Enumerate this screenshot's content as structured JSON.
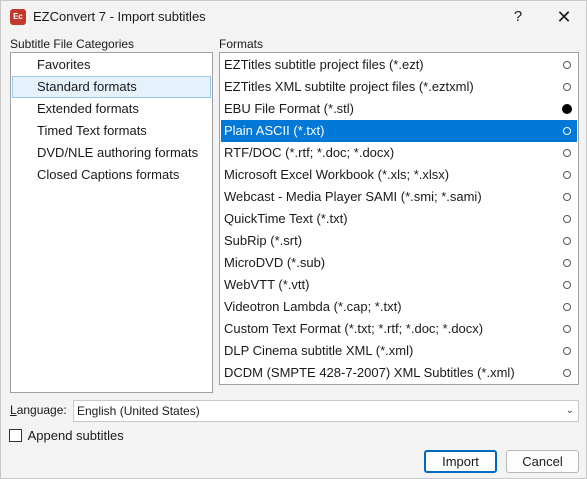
{
  "window": {
    "app_icon_text": "Ec",
    "title": "EZConvert 7 - Import subtitles",
    "help_glyph": "?",
    "close_glyph": "✕"
  },
  "categories": {
    "label": "Subtitle File Categories",
    "items": [
      {
        "label": "Favorites",
        "selected": false
      },
      {
        "label": "Standard formats",
        "selected": true
      },
      {
        "label": "Extended formats",
        "selected": false
      },
      {
        "label": "Timed Text formats",
        "selected": false
      },
      {
        "label": "DVD/NLE authoring formats",
        "selected": false
      },
      {
        "label": "Closed Captions formats",
        "selected": false
      }
    ]
  },
  "formats": {
    "label": "Formats",
    "items": [
      {
        "label": "EZTitles subtitle project files (*.ezt)",
        "marker": "hollow"
      },
      {
        "label": "EZTitles XML subtilte project files (*.eztxml)",
        "marker": "hollow"
      },
      {
        "label": "EBU File Format (*.stl)",
        "marker": "filled"
      },
      {
        "label": "Plain ASCII (*.txt)",
        "marker": "hollow",
        "selected": true
      },
      {
        "label": "RTF/DOC (*.rtf; *.doc; *.docx)",
        "marker": "hollow"
      },
      {
        "label": "Microsoft Excel Workbook (*.xls; *.xlsx)",
        "marker": "hollow"
      },
      {
        "label": "Webcast - Media Player SAMI (*.smi; *.sami)",
        "marker": "hollow"
      },
      {
        "label": "QuickTime Text (*.txt)",
        "marker": "hollow"
      },
      {
        "label": "SubRip (*.srt)",
        "marker": "hollow"
      },
      {
        "label": "MicroDVD (*.sub)",
        "marker": "hollow"
      },
      {
        "label": "WebVTT (*.vtt)",
        "marker": "hollow"
      },
      {
        "label": "Videotron Lambda (*.cap; *.txt)",
        "marker": "hollow"
      },
      {
        "label": "Custom Text Format (*.txt; *.rtf; *.doc; *.docx)",
        "marker": "hollow"
      },
      {
        "label": "DLP Cinema subtitle XML (*.xml)",
        "marker": "hollow"
      },
      {
        "label": "DCDM (SMPTE 428-7-2007) XML Subtitles (*.xml)",
        "marker": "hollow"
      }
    ]
  },
  "language": {
    "label_first": "L",
    "label_rest": "anguage:",
    "value": "English (United States)"
  },
  "append": {
    "label": "Append subtitles",
    "checked": false
  },
  "buttons": {
    "import": "Import",
    "cancel": "Cancel"
  },
  "colors": {
    "selection": "#0078d7",
    "category_selection": "#e5f1fb",
    "accent_border": "#0067c0"
  }
}
